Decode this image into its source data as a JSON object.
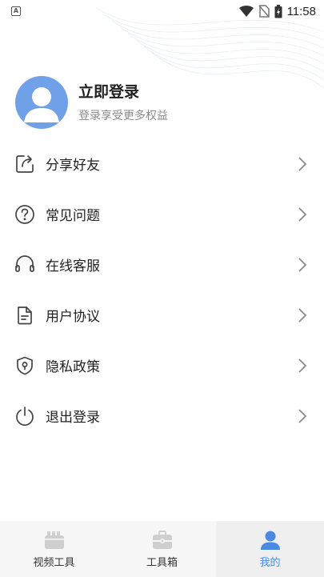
{
  "status_bar": {
    "time": "11:58",
    "left_badge": "A"
  },
  "profile": {
    "title": "立即登录",
    "subtitle": "登录享受更多权益"
  },
  "menu": {
    "items": [
      {
        "label": "分享好友",
        "icon": "share-icon"
      },
      {
        "label": "常见问题",
        "icon": "question-icon"
      },
      {
        "label": "在线客服",
        "icon": "headset-icon"
      },
      {
        "label": "用户协议",
        "icon": "document-icon"
      },
      {
        "label": "隐私政策",
        "icon": "shield-icon"
      },
      {
        "label": "退出登录",
        "icon": "power-icon"
      }
    ]
  },
  "bottom_nav": {
    "tabs": [
      {
        "label": "视频工具",
        "icon": "video-tool-icon",
        "active": false
      },
      {
        "label": "工具箱",
        "icon": "toolbox-icon",
        "active": false
      },
      {
        "label": "我的",
        "icon": "user-icon",
        "active": true
      }
    ]
  },
  "colors": {
    "accent": "#4a8ae3",
    "avatar_bg": "#6fa0e8",
    "inactive_icon": "#cfcfcf"
  }
}
